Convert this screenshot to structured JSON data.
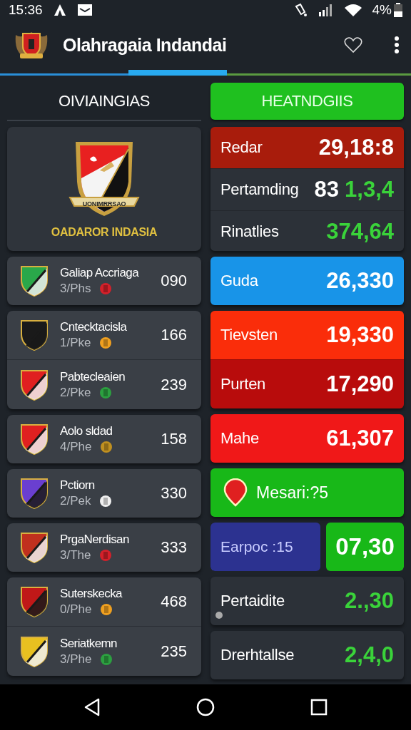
{
  "status_bar": {
    "time": "15:36",
    "battery": "4%"
  },
  "app_bar": {
    "title": "Olahragaia Indandai"
  },
  "tabs": [
    {
      "label": "OIVIAINGIAS",
      "selected": false
    },
    {
      "label": "HEATNDGIIS",
      "selected": true
    }
  ],
  "featured": {
    "banner": "UONIMRRSAO",
    "name": "OADAROR INDASIA"
  },
  "team_cards": [
    {
      "teams": [
        {
          "name": "Galiap Accriaga",
          "code": "3/Phs",
          "score": "090",
          "color": "#2aa84a"
        }
      ]
    },
    {
      "teams": [
        {
          "name": "Cntecktacisla",
          "code": "1/Pke",
          "score": "166",
          "color": "#1a1a1a"
        },
        {
          "name": "Pabtecleaien",
          "code": "2/Pke",
          "score": "239",
          "color": "#e02020"
        }
      ]
    },
    {
      "teams": [
        {
          "name": "Aolo sldad",
          "code": "4/Phe",
          "score": "158",
          "color": "#e02020"
        }
      ]
    },
    {
      "teams": [
        {
          "name": "Pctiorn",
          "code": "2/Pek",
          "score": "330",
          "color": "#6a3fd0"
        }
      ]
    },
    {
      "teams": [
        {
          "name": "PrgaNerdisan",
          "code": "3/The",
          "score": "333",
          "color": "#c0301e"
        }
      ]
    },
    {
      "teams": [
        {
          "name": "Suterskecka",
          "code": "0/Phe",
          "score": "468",
          "color": "#c01818"
        },
        {
          "name": "Seriatkemn",
          "code": "3/Phe",
          "score": "235",
          "color": "#e8c020"
        }
      ]
    }
  ],
  "panels": [
    {
      "kind": "stats",
      "rows": [
        {
          "label": "Redar",
          "value": "29,18:8",
          "color": "#a81c0c",
          "accent": false
        },
        {
          "label": "Pertamding",
          "value": "83",
          "accent_value": "1,3,4",
          "color": "#2c3138",
          "accent": false
        },
        {
          "label": "Rinatlies",
          "value": "374,64",
          "color": "#2c3138",
          "accent": true
        }
      ]
    },
    {
      "kind": "stats",
      "rows": [
        {
          "label": "Guda",
          "value": "26,330",
          "color": "#1894e8",
          "accent": false
        }
      ]
    },
    {
      "kind": "stats",
      "rows": [
        {
          "label": "Tievsten",
          "value": "19,330",
          "color": "#fa2d0a",
          "accent": false
        },
        {
          "label": "Purten",
          "value": "17,290",
          "color": "#b80c0c",
          "accent": false
        }
      ]
    },
    {
      "kind": "stats",
      "rows": [
        {
          "label": "Mahe",
          "value": "61,307",
          "color": "#f01818",
          "accent": false
        }
      ]
    },
    {
      "kind": "pin",
      "label": "Mesari:?5",
      "color": "#18b818"
    },
    {
      "kind": "split",
      "tiles": [
        {
          "text": "Earpoc :15",
          "color": "#2c3290"
        },
        {
          "text": "07,30",
          "color": "#18b818"
        }
      ]
    },
    {
      "kind": "stats",
      "dot": true,
      "rows": [
        {
          "label": "Pertaidite",
          "value": "2.,30",
          "color": "#2c3138",
          "accent": true
        }
      ]
    },
    {
      "kind": "stats",
      "rows": [
        {
          "label": "Drerhtallse",
          "value": "2,4,0",
          "color": "#2c3138",
          "accent": true
        }
      ]
    }
  ]
}
